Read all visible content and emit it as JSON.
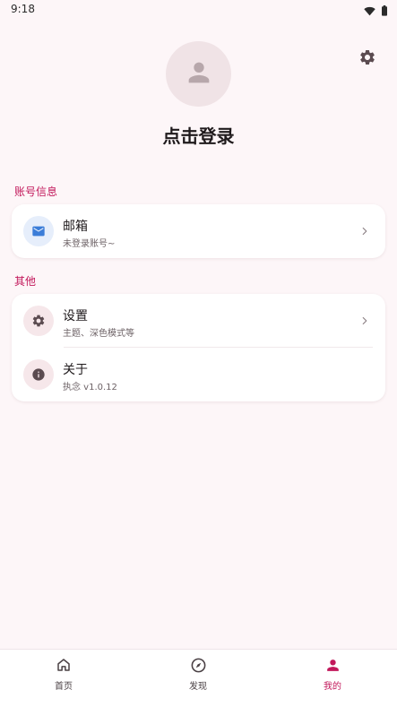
{
  "status_bar": {
    "time": "9:18"
  },
  "header": {
    "login_text": "点击登录"
  },
  "sections": {
    "account": {
      "label": "账号信息",
      "items": [
        {
          "title": "邮箱",
          "subtitle": "未登录账号~"
        }
      ]
    },
    "other": {
      "label": "其他",
      "items": [
        {
          "title": "设置",
          "subtitle": "主题、深色模式等"
        },
        {
          "title": "关于",
          "subtitle": "执念 v1.0.12"
        }
      ]
    }
  },
  "bottom_nav": {
    "items": [
      {
        "label": "首页"
      },
      {
        "label": "发现"
      },
      {
        "label": "我的"
      }
    ],
    "active": "我的"
  },
  "colors": {
    "accent": "#c2185b",
    "background": "#fdf6f8",
    "mail_icon": "#3b7dd8",
    "icon_dark": "#5b4b50"
  },
  "icons": [
    "wifi-icon",
    "battery-icon",
    "gear-icon",
    "person-icon",
    "mail-icon",
    "info-icon",
    "chevron-right-icon",
    "home-icon",
    "compass-icon"
  ]
}
